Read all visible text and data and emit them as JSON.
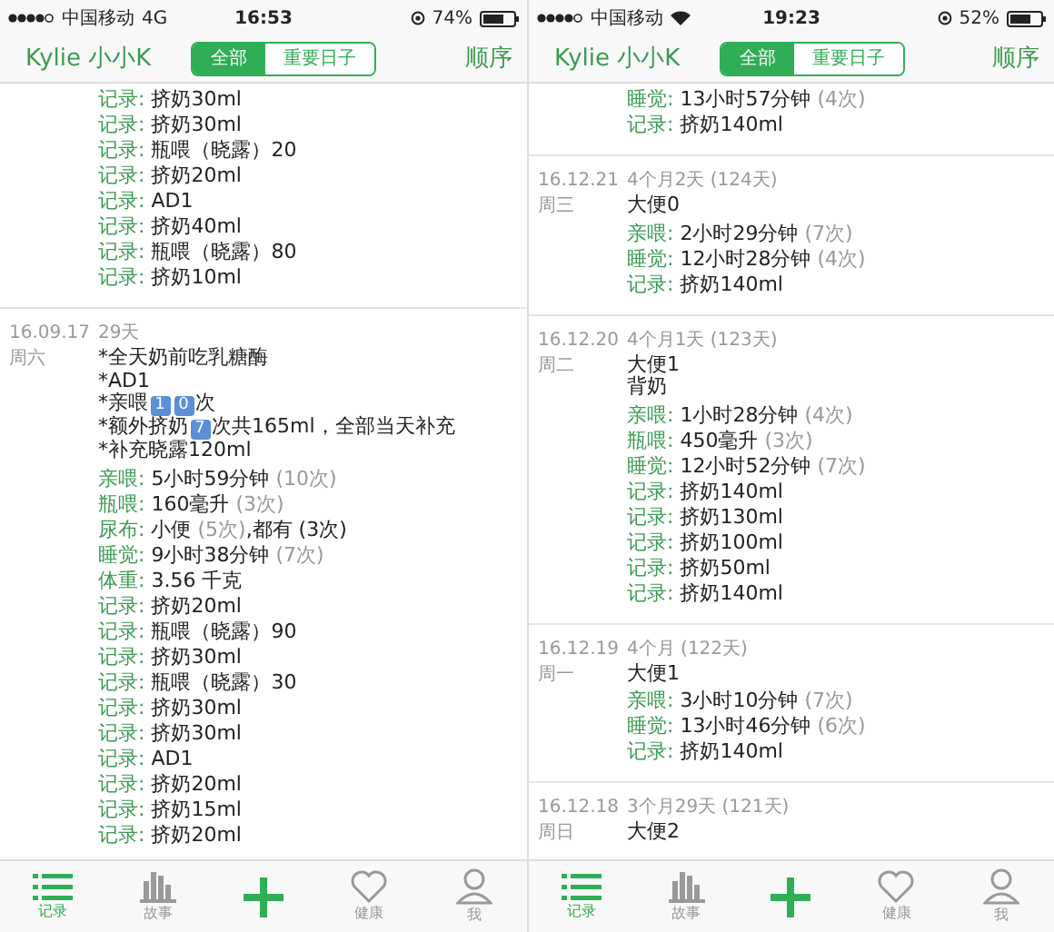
{
  "screens": [
    {
      "status_bar": {
        "carrier": "中国移动",
        "kind": "cellular",
        "network": "4G",
        "time": "16:53",
        "battery": "74%"
      },
      "header": {
        "title": "Kylie 小小K",
        "segments": [
          {
            "label": "全部",
            "selected": true
          },
          {
            "label": "重要日子",
            "selected": false
          }
        ],
        "action": "顺序"
      },
      "entries": [
        {
          "records": [
            {
              "label": "记录:",
              "value": "挤奶30ml"
            },
            {
              "label": "记录:",
              "value": "挤奶30ml"
            },
            {
              "label": "记录:",
              "value": "瓶喂（晓露）20"
            },
            {
              "label": "记录:",
              "value": "挤奶20ml"
            },
            {
              "label": "记录:",
              "value": "AD1"
            },
            {
              "label": "记录:",
              "value": "挤奶40ml"
            },
            {
              "label": "记录:",
              "value": "瓶喂（晓露）80"
            },
            {
              "label": "记录:",
              "value": "挤奶10ml"
            }
          ]
        },
        {
          "date": "16.09.17",
          "weekday": "周六",
          "age": "29天",
          "notes": [
            [
              {
                "kind": "text",
                "text": "*全天奶前吃乳糖酶"
              }
            ],
            [
              {
                "kind": "text",
                "text": "*AD1"
              }
            ],
            [
              {
                "kind": "text",
                "text": "*亲喂"
              },
              {
                "kind": "keycap",
                "text": "1"
              },
              {
                "kind": "keycap",
                "text": "0"
              },
              {
                "kind": "text",
                "text": "次"
              }
            ],
            [
              {
                "kind": "text",
                "text": "*额外挤奶"
              },
              {
                "kind": "keycap",
                "text": "7"
              },
              {
                "kind": "text",
                "text": "次共165ml，全部当天补充"
              }
            ],
            [
              {
                "kind": "text",
                "text": "*补充晓露120ml"
              }
            ]
          ],
          "records": [
            {
              "label": "亲喂:",
              "value": "5小时59分钟",
              "count": "(10次)"
            },
            {
              "label": "瓶喂:",
              "value": "160毫升",
              "count": "(3次)"
            },
            {
              "label": "尿布:",
              "value": "小便",
              "count": "(5次)",
              "tail": ",都有 (3次)"
            },
            {
              "label": "睡觉:",
              "value": "9小时38分钟",
              "count": "(7次)"
            },
            {
              "label": "体重:",
              "value": "3.56 千克"
            },
            {
              "label": "记录:",
              "value": "挤奶20ml"
            },
            {
              "label": "记录:",
              "value": "瓶喂（晓露）90"
            },
            {
              "label": "记录:",
              "value": "挤奶30ml"
            },
            {
              "label": "记录:",
              "value": "瓶喂（晓露）30"
            },
            {
              "label": "记录:",
              "value": "挤奶30ml"
            },
            {
              "label": "记录:",
              "value": "挤奶30ml"
            },
            {
              "label": "记录:",
              "value": "AD1"
            },
            {
              "label": "记录:",
              "value": "挤奶20ml"
            },
            {
              "label": "记录:",
              "value": "挤奶15ml"
            },
            {
              "label": "记录:",
              "value": "挤奶20ml"
            }
          ]
        }
      ],
      "tabs": [
        {
          "kind": "list",
          "label": "记录",
          "selected": true
        },
        {
          "kind": "story",
          "label": "故事",
          "selected": false
        },
        {
          "kind": "add"
        },
        {
          "kind": "heart",
          "label": "健康",
          "selected": false
        },
        {
          "kind": "person",
          "label": "我",
          "selected": false
        }
      ]
    },
    {
      "status_bar": {
        "carrier": "中国移动",
        "kind": "wifi",
        "time": "19:23",
        "battery": "52%"
      },
      "header": {
        "title": "Kylie 小小K",
        "segments": [
          {
            "label": "全部",
            "selected": true
          },
          {
            "label": "重要日子",
            "selected": false
          }
        ],
        "action": "顺序"
      },
      "entries": [
        {
          "records": [
            {
              "label": "睡觉:",
              "value": "13小时57分钟",
              "count": "(4次)"
            },
            {
              "label": "记录:",
              "value": "挤奶140ml"
            }
          ]
        },
        {
          "date": "16.12.21",
          "weekday": "周三",
          "age": "4个月2天 (124天)",
          "notes": [
            [
              {
                "kind": "text",
                "text": "大便0"
              }
            ]
          ],
          "records": [
            {
              "label": "亲喂:",
              "value": "2小时29分钟",
              "count": "(7次)"
            },
            {
              "label": "睡觉:",
              "value": "12小时28分钟",
              "count": "(4次)"
            },
            {
              "label": "记录:",
              "value": "挤奶140ml"
            }
          ]
        },
        {
          "date": "16.12.20",
          "weekday": "周二",
          "age": "4个月1天 (123天)",
          "notes": [
            [
              {
                "kind": "text",
                "text": "大便1"
              }
            ],
            [
              {
                "kind": "text",
                "text": "背奶"
              }
            ]
          ],
          "records": [
            {
              "label": "亲喂:",
              "value": "1小时28分钟",
              "count": "(4次)"
            },
            {
              "label": "瓶喂:",
              "value": "450毫升",
              "count": "(3次)"
            },
            {
              "label": "睡觉:",
              "value": "12小时52分钟",
              "count": "(7次)"
            },
            {
              "label": "记录:",
              "value": "挤奶140ml"
            },
            {
              "label": "记录:",
              "value": "挤奶130ml"
            },
            {
              "label": "记录:",
              "value": "挤奶100ml"
            },
            {
              "label": "记录:",
              "value": "挤奶50ml"
            },
            {
              "label": "记录:",
              "value": "挤奶140ml"
            }
          ]
        },
        {
          "date": "16.12.19",
          "weekday": "周一",
          "age": "4个月 (122天)",
          "notes": [
            [
              {
                "kind": "text",
                "text": "大便1"
              }
            ]
          ],
          "records": [
            {
              "label": "亲喂:",
              "value": "3小时10分钟",
              "count": "(7次)"
            },
            {
              "label": "睡觉:",
              "value": "13小时46分钟",
              "count": "(6次)"
            },
            {
              "label": "记录:",
              "value": "挤奶140ml"
            }
          ]
        },
        {
          "date": "16.12.18",
          "weekday": "周日",
          "age": "3个月29天 (121天)",
          "notes": [
            [
              {
                "kind": "text",
                "text": "大便2"
              }
            ]
          ]
        }
      ],
      "tabs": [
        {
          "kind": "list",
          "label": "记录",
          "selected": true
        },
        {
          "kind": "story",
          "label": "故事",
          "selected": false
        },
        {
          "kind": "add"
        },
        {
          "kind": "heart",
          "label": "健康",
          "selected": false
        },
        {
          "kind": "person",
          "label": "我",
          "selected": false
        }
      ]
    }
  ]
}
